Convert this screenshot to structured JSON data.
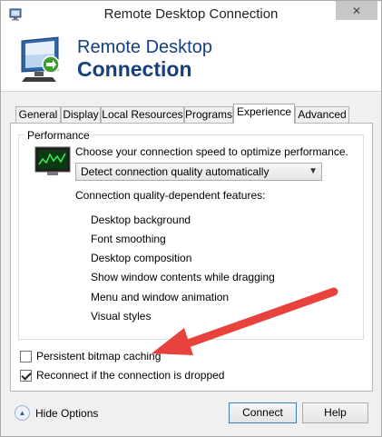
{
  "window": {
    "title": "Remote Desktop Connection",
    "close_glyph": "✕"
  },
  "banner": {
    "line1": "Remote Desktop",
    "line2": "Connection"
  },
  "tabs": [
    {
      "label": "General"
    },
    {
      "label": "Display"
    },
    {
      "label": "Local Resources"
    },
    {
      "label": "Programs"
    },
    {
      "label": "Experience",
      "active": true
    },
    {
      "label": "Advanced"
    }
  ],
  "performance": {
    "group_label": "Performance",
    "speed_label": "Choose your connection speed to optimize performance.",
    "speed_selected": "Detect connection quality automatically",
    "features_label": "Connection quality-dependent features:",
    "features": [
      "Desktop background",
      "Font smoothing",
      "Desktop composition",
      "Show window contents while dragging",
      "Menu and window animation",
      "Visual styles"
    ]
  },
  "options": {
    "persistent_bitmap": {
      "label": "Persistent bitmap caching",
      "checked": false
    },
    "reconnect": {
      "label": "Reconnect if the connection is dropped",
      "checked": true
    }
  },
  "footer": {
    "hide_options": "Hide Options",
    "connect": "Connect",
    "help": "Help"
  },
  "colors": {
    "banner_text": "#163f7d",
    "arrow": "#e8423d"
  }
}
